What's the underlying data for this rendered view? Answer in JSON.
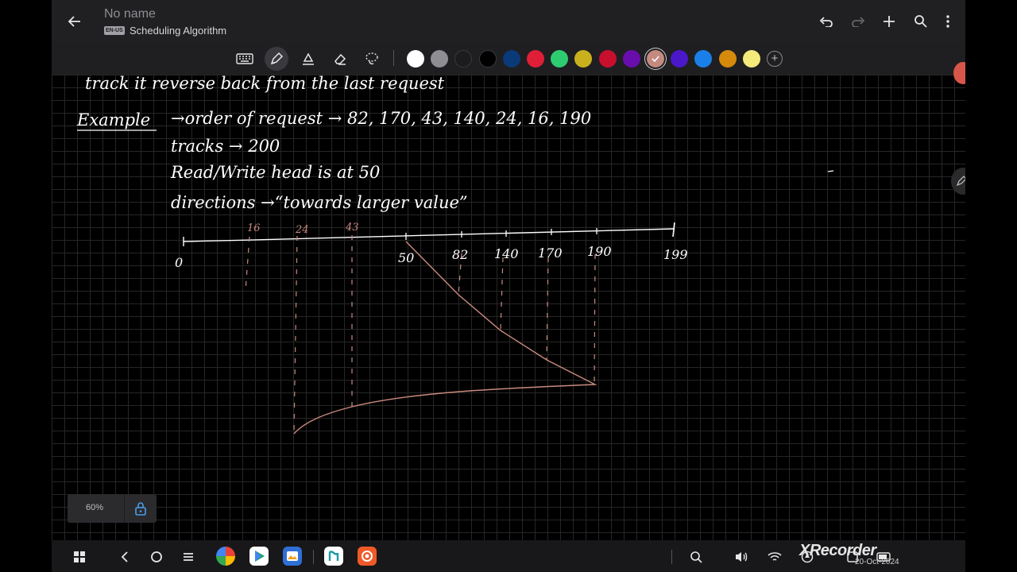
{
  "app": {
    "title": "No name",
    "lang_badge": "EN-US",
    "subtitle": "Scheduling Algorithm"
  },
  "toolbar": {
    "tools": [
      "keyboard-icon",
      "pen-icon",
      "highlighter-icon",
      "eraser-icon",
      "lasso-icon"
    ],
    "colors": [
      "#ffffff",
      "#8e8e93",
      "#1c1c1e",
      "#000000",
      "#0a3a78",
      "#e01e37",
      "#2ecc71",
      "#c9b11e",
      "#c8102e",
      "#6a0dad",
      "#c48a80",
      "#4b17c9",
      "#1a7fe8",
      "#d68a0c",
      "#f3ea7a"
    ],
    "selected_color": "#c48a80",
    "add_color_symbol": "+"
  },
  "notes": {
    "line0": "track it reverse back from the last request",
    "example_label": "Example",
    "order_line": "→order of request → 82, 170, 43, 140, 24, 16, 190",
    "tracks_line": "tracks → 200",
    "head_line": "Read/Write head is at 50",
    "direction_line": "directions →“towards larger value”"
  },
  "diagram": {
    "axis_start": "0",
    "axis_end": "199",
    "axis_labels": [
      "50",
      "82",
      "140",
      "170",
      "190"
    ],
    "upper_labels": [
      "16",
      "24",
      "43"
    ]
  },
  "zoom": {
    "level": "60%"
  },
  "recorder": {
    "watermark": "XRecorder",
    "date": "20-Oct-2024"
  }
}
